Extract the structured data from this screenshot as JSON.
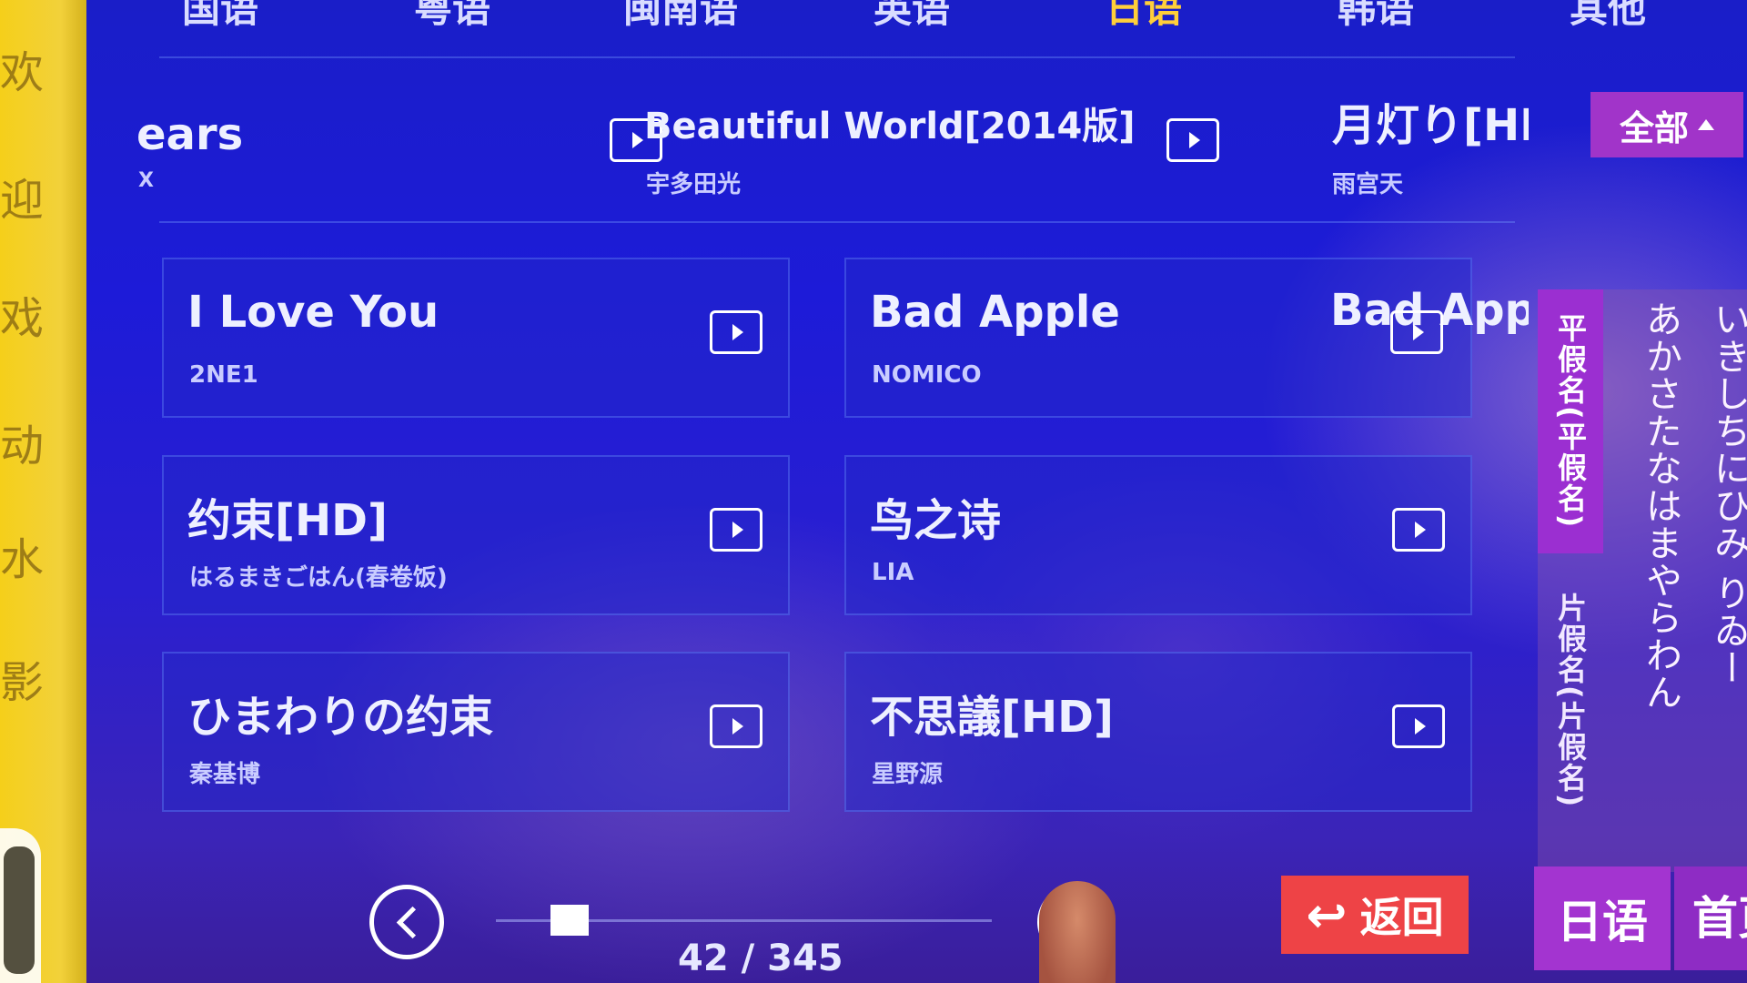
{
  "tabs": [
    "国语",
    "粤语",
    "闽南语",
    "英语",
    "日语",
    "韩语",
    "其他"
  ],
  "active_tab": "日语",
  "songs": [
    {
      "title": "Tears",
      "title_visible": "ears",
      "artist": "X"
    },
    {
      "title": "Beautiful World[2014版]",
      "artist": "宇多田光"
    },
    {
      "title": "月灯り[HD]",
      "title_visible": "月灯り[HI",
      "artist": "雨宫天"
    },
    {
      "title": "I Love You",
      "artist": "2NE1"
    },
    {
      "title": "Bad Apple",
      "artist": "NOMICO"
    },
    {
      "title": "Bad Apple",
      "title_visible": "Bad Appl",
      "artist": ""
    },
    {
      "title": "约束[HD]",
      "artist": "はるまきごはん(春卷饭)"
    },
    {
      "title": "鸟之诗",
      "artist": "LIA"
    },
    {
      "title": "ひまわりの约束",
      "artist": "秦基博"
    },
    {
      "title": "不思議[HD]",
      "artist": "星野源"
    }
  ],
  "filter": {
    "all_label": "全部"
  },
  "kana": {
    "hiragana_label": "平假名(平假名)",
    "katakana_label": "片假名(片假名)",
    "column_a": "あかさたなはまやらわん",
    "column_i": "いきしちにひみ りゐー"
  },
  "pagination": {
    "counter": "42 / 345",
    "current": 42,
    "total": 345,
    "progress": 0.12
  },
  "bottom": {
    "back_label": "返回",
    "lang_label": "日语",
    "home_label": "首页"
  },
  "poster_chars": [
    "欢",
    "迎",
    "戏",
    "动",
    "水",
    "影"
  ],
  "colors": {
    "accent_purple": "#a134c9",
    "back_red": "#ee4346",
    "active_tab": "#ffcf3a",
    "background_blue": "#1d1bd8"
  }
}
